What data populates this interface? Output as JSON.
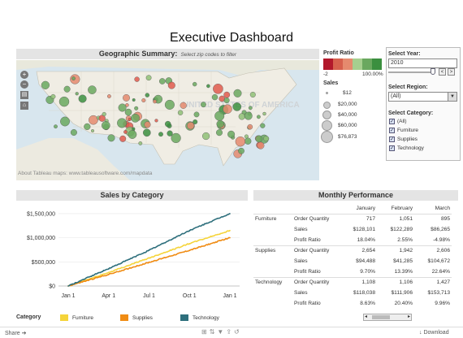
{
  "dashboard": {
    "title": "Executive Dashboard"
  },
  "geo": {
    "title": "Geographic Summary:",
    "hint": "Select zip codes to filter",
    "watermark": "UNITED STATES OF AMERICA",
    "credit": "About Tableau maps: www.tableausoftware.com/mapdata"
  },
  "profit_legend": {
    "title": "Profit Ratio",
    "min": "-2",
    "max": "100.00%",
    "colors": [
      "#b2182b",
      "#d6604d",
      "#e58a6e",
      "#a6cf8f",
      "#6aa85f",
      "#3b8f3f"
    ]
  },
  "sales_legend": {
    "title": "Sales",
    "items": [
      "$12",
      "$20,000",
      "$40,000",
      "$60,000",
      "$76,873"
    ]
  },
  "filters": {
    "year_label": "Select Year:",
    "year_value": "2010",
    "region_label": "Select Region:",
    "region_value": "(All)",
    "category_label": "Select Category:",
    "categories": [
      "(All)",
      "Furniture",
      "Supplies",
      "Technology"
    ]
  },
  "sales_by_category": {
    "title": "Sales by Category",
    "legend_label": "Category",
    "legend": [
      "Furniture",
      "Supplies",
      "Technology"
    ],
    "colors": {
      "Furniture": "#f5d43a",
      "Supplies": "#f08c14",
      "Technology": "#2e6f7c"
    }
  },
  "chart_data": {
    "type": "line",
    "title": "Sales by Category",
    "x": [
      "Jan 1",
      "Apr 1",
      "Jul 1",
      "Oct 1",
      "Jan 1"
    ],
    "yticks": [
      "$1,500,000",
      "$1,000,000",
      "$500,000",
      "$0"
    ],
    "ylim": [
      0,
      1600000
    ],
    "series": [
      {
        "name": "Furniture",
        "values": [
          0,
          280000,
          580000,
          880000,
          1150000
        ]
      },
      {
        "name": "Supplies",
        "values": [
          0,
          240000,
          490000,
          740000,
          1000000
        ]
      },
      {
        "name": "Technology",
        "values": [
          0,
          360000,
          740000,
          1150000,
          1500000
        ]
      }
    ]
  },
  "monthly": {
    "title": "Monthly Performance",
    "months": [
      "January",
      "February",
      "March"
    ],
    "rows": [
      {
        "cat": "Furniture",
        "measure": "Order Quantity",
        "v": [
          "717",
          "1,051",
          "895"
        ]
      },
      {
        "cat": "",
        "measure": "Sales",
        "v": [
          "$128,101",
          "$122,289",
          "$86,265"
        ]
      },
      {
        "cat": "",
        "measure": "Profit Ratio",
        "v": [
          "18.04%",
          "2.55%",
          "-4.98%"
        ]
      },
      {
        "cat": "Supplies",
        "measure": "Order Quantity",
        "v": [
          "2,654",
          "1,942",
          "2,606"
        ]
      },
      {
        "cat": "",
        "measure": "Sales",
        "v": [
          "$94,488",
          "$41,285",
          "$104,672"
        ]
      },
      {
        "cat": "",
        "measure": "Profit Ratio",
        "v": [
          "9.70%",
          "13.39%",
          "22.64%"
        ]
      },
      {
        "cat": "Technology",
        "measure": "Order Quantity",
        "v": [
          "1,108",
          "1,106",
          "1,427"
        ]
      },
      {
        "cat": "",
        "measure": "Sales",
        "v": [
          "$118,038",
          "$111,906",
          "$153,713"
        ]
      },
      {
        "cat": "",
        "measure": "Profit Ratio",
        "v": [
          "8.63%",
          "20.40%",
          "9.96%"
        ]
      }
    ]
  },
  "footer": {
    "share": "Share",
    "download": "Download"
  }
}
